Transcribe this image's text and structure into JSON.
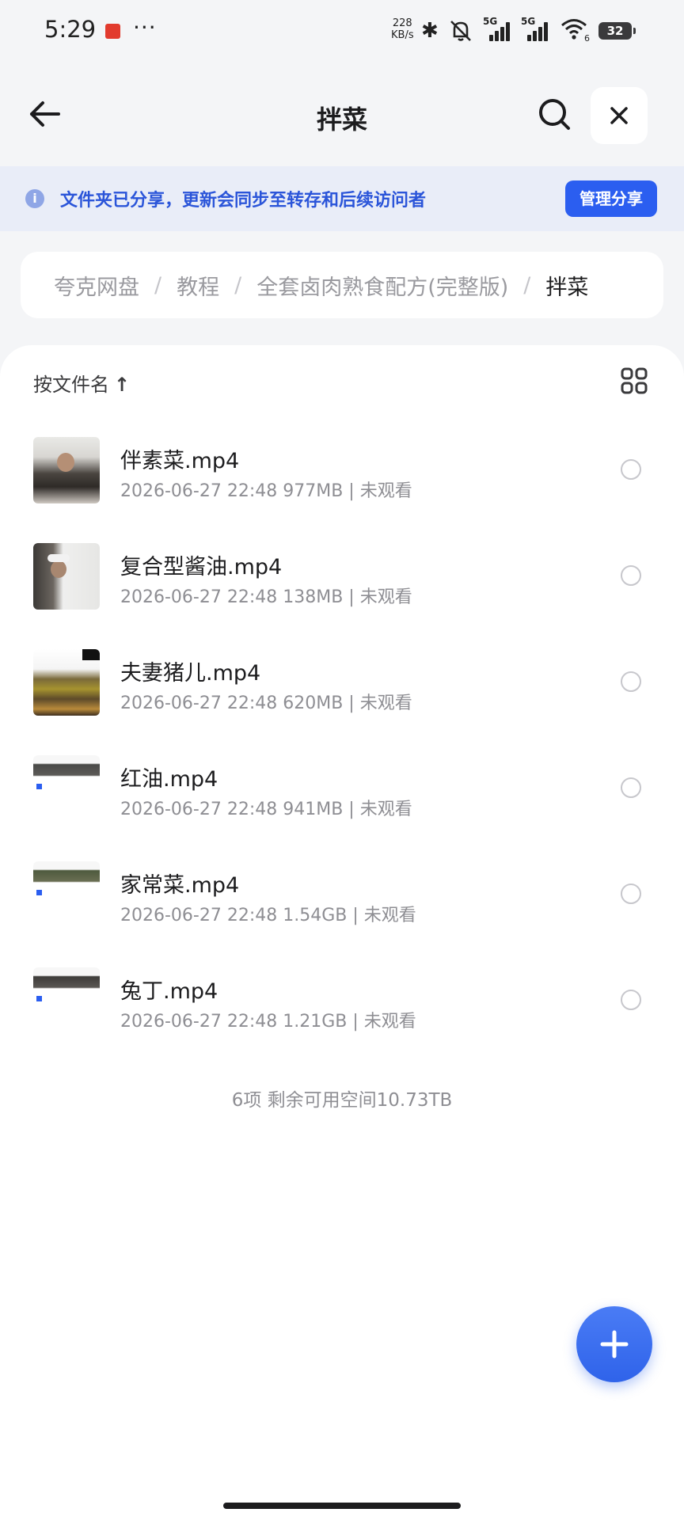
{
  "status_bar": {
    "time": "5:29",
    "dots": "···",
    "speed_value": "228",
    "speed_unit": "KB/s",
    "net1": "5G",
    "net2": "5G",
    "wifi_sub": "6",
    "battery": "32"
  },
  "header": {
    "title": "拌菜"
  },
  "banner": {
    "message": "文件夹已分享，更新会同步至转存和后续访问者",
    "manage_label": "管理分享"
  },
  "breadcrumb": {
    "items": [
      "夸克网盘",
      "教程",
      "全套卤肉熟食配方(完整版)"
    ],
    "current": "拌菜",
    "separator": "/"
  },
  "list": {
    "sort_label": "按文件名",
    "sort_arrow": "↑",
    "files": [
      {
        "name": "伴素菜.mp4",
        "meta": "2026-06-27 22:48  977MB | 未观看"
      },
      {
        "name": "复合型酱油.mp4",
        "meta": "2026-06-27 22:48  138MB | 未观看"
      },
      {
        "name": "夫妻猪儿.mp4",
        "meta": "2026-06-27 22:48  620MB | 未观看"
      },
      {
        "name": "红油.mp4",
        "meta": "2026-06-27 22:48  941MB | 未观看"
      },
      {
        "name": "家常菜.mp4",
        "meta": "2026-06-27 22:48  1.54GB | 未观看"
      },
      {
        "name": "兔丁.mp4",
        "meta": "2026-06-27 22:48  1.21GB | 未观看"
      }
    ],
    "summary": "6项 剩余可用空间10.73TB"
  },
  "colors": {
    "accent": "#2b5ef0",
    "banner_bg": "#e9edf8"
  }
}
